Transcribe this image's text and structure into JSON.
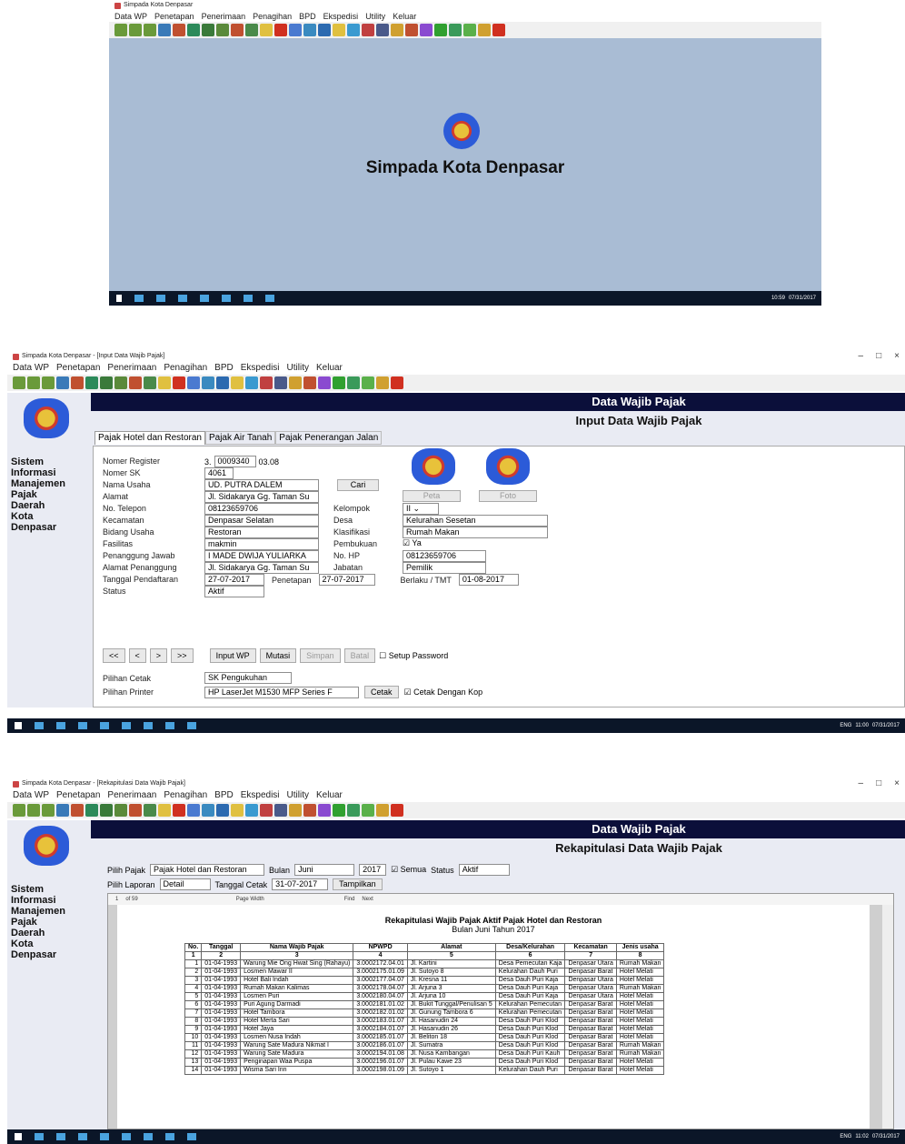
{
  "shot1": {
    "title": "Simpada Kota Denpasar",
    "menu": [
      "Data WP",
      "Penetapan",
      "Penerimaan",
      "Penagihan",
      "BPD",
      "Ekspedisi",
      "Utility",
      "Keluar"
    ],
    "splash_text": "Simpada Kota Denpasar",
    "clock_time": "10:59",
    "clock_date": "07/31/2017"
  },
  "shot2": {
    "title": "Simpada Kota Denpasar - [Input Data Wajib Pajak]",
    "menu": [
      "Data WP",
      "Penetapan",
      "Penerimaan",
      "Penagihan",
      "BPD",
      "Ekspedisi",
      "Utility",
      "Keluar"
    ],
    "header_title": "Data Wajib Pajak",
    "header_subtitle": "Input Data Wajib Pajak",
    "sidebar_text": [
      "Sistem",
      "Informasi",
      "Manajemen",
      "Pajak",
      "Daerah",
      "Kota",
      "Denpasar"
    ],
    "tabs": [
      "Pajak Hotel dan Restoran",
      "Pajak Air Tanah",
      "Pajak Penerangan Jalan"
    ],
    "labels": {
      "nomer_register": "Nomer Register",
      "nomer_sk": "Nomer SK",
      "nama_usaha": "Nama Usaha",
      "alamat": "Alamat",
      "no_telepon": "No. Telepon",
      "kecamatan": "Kecamatan",
      "bidang_usaha": "Bidang Usaha",
      "fasilitas": "Fasilitas",
      "penanggung_jawab": "Penanggung Jawab",
      "alamat_penanggung": "Alamat Penanggung",
      "tanggal_pendaftaran": "Tanggal Pendaftaran",
      "status": "Status",
      "kelompok": "Kelompok",
      "desa": "Desa",
      "klasifikasi": "Klasifikasi",
      "pembukuan": "Pembukuan",
      "no_hp": "No. HP",
      "jabatan": "Jabatan",
      "penetapan": "Penetapan",
      "berlaku": "Berlaku / TMT",
      "pilihan_cetak": "Pilihan Cetak",
      "pilihan_printer": "Pilihan Printer"
    },
    "values": {
      "reg_prefix": "3.",
      "reg_number": "0009340",
      "reg_suffix": "03.08",
      "nomer_sk": "4061",
      "nama_usaha": "UD. PUTRA DALEM",
      "alamat": "Jl. Sidakarya Gg. Taman Su",
      "no_telepon": "08123659706",
      "kecamatan": "Denpasar Selatan",
      "bidang_usaha": "Restoran",
      "fasilitas": "makmin",
      "penanggung_jawab": "I MADE DWIJA YULIARKA",
      "alamat_penanggung": "Jl. Sidakarya Gg. Taman Su",
      "tanggal_pendaftaran": "27-07-2017",
      "status": "Aktif",
      "kelompok": "II",
      "desa": "Kelurahan Sesetan",
      "klasifikasi": "Rumah Makan",
      "pembukuan": "Ya",
      "no_hp": "08123659706",
      "jabatan": "Pemilik",
      "penetapan": "27-07-2017",
      "berlaku": "01-08-2017",
      "pilihan_cetak": "SK Pengukuhan",
      "pilihan_printer": "HP LaserJet M1530 MFP Series F",
      "cetak_dengan_kop": "Cetak Dengan Kop",
      "setup_password": "Setup Password"
    },
    "buttons": {
      "cari": "Cari",
      "peta": "Peta",
      "foto": "Foto",
      "first": "<<",
      "prev": "<",
      "next": ">",
      "last": ">>",
      "input_wp": "Input WP",
      "mutasi": "Mutasi",
      "simpan": "Simpan",
      "batal": "Batal",
      "cetak": "Cetak"
    },
    "clock_time": "11:00",
    "clock_date": "07/31/2017",
    "lang": "ENG"
  },
  "shot3": {
    "title": "Simpada Kota Denpasar - [Rekapitulasi Data Wajib Pajak]",
    "menu": [
      "Data WP",
      "Penetapan",
      "Penerimaan",
      "Penagihan",
      "BPD",
      "Ekspedisi",
      "Utility",
      "Keluar"
    ],
    "header_title": "Data Wajib Pajak",
    "header_subtitle": "Rekapitulasi Data Wajib Pajak",
    "sidebar_text": [
      "Sistem",
      "Informasi",
      "Manajemen",
      "Pajak",
      "Daerah",
      "Kota",
      "Denpasar"
    ],
    "filters": {
      "pilih_pajak_label": "Pilih Pajak",
      "pilih_pajak": "Pajak Hotel dan Restoran",
      "bulan_label": "Bulan",
      "bulan": "Juni",
      "tahun": "2017",
      "semua": "Semua",
      "status_label": "Status",
      "status": "Aktif",
      "pilih_laporan_label": "Pilih Laporan",
      "pilih_laporan": "Detail",
      "tanggal_cetak_label": "Tanggal Cetak",
      "tanggal_cetak": "31-07-2017",
      "tampilkan": "Tampilkan"
    },
    "report_toolbar": {
      "page": "1",
      "of": "of 59",
      "zoom": "Page Width",
      "find": "Find",
      "next": "Next"
    },
    "report_title": "Rekapitulasi Wajib Pajak Aktif Pajak Hotel dan Restoran",
    "report_subtitle": "Bulan Juni Tahun 2017",
    "columns": [
      "No.",
      "Tanggal",
      "Nama Wajib Pajak",
      "NPWPD",
      "Alamat",
      "Desa/Kelurahan",
      "Kecamatan",
      "Jenis usaha"
    ],
    "column_numbers": [
      "1",
      "2",
      "3",
      "4",
      "5",
      "6",
      "7",
      "8"
    ],
    "rows": [
      [
        "1",
        "01-04-1993",
        "Warung Mie Ong Hwat Sing (Rahayu)",
        "3.0002172.04.01",
        "Jl. Kartini",
        "Desa Pemecutan Kaja",
        "Denpasar Utara",
        "Rumah Makan"
      ],
      [
        "2",
        "01-04-1993",
        "Losmen Mawar II",
        "3.0002175.01.09",
        "Jl. Sutoyo 8",
        "Kelurahan Dauh Puri",
        "Denpasar Barat",
        "Hotel Melati"
      ],
      [
        "3",
        "01-04-1993",
        "Hotel Bali Indah",
        "3.0002177.04.07",
        "Jl. Kresna 11",
        "Desa Dauh Puri Kaja",
        "Denpasar Utara",
        "Hotel Melati"
      ],
      [
        "4",
        "01-04-1993",
        "Rumah Makan Kalimas",
        "3.0002178.04.07",
        "Jl. Arjuna 3",
        "Desa Dauh Puri Kaja",
        "Denpasar Utara",
        "Rumah Makan"
      ],
      [
        "5",
        "01-04-1993",
        "Losmen Puri",
        "3.0002180.04.07",
        "Jl. Arjuna 10",
        "Desa Dauh Puri Kaja",
        "Denpasar Utara",
        "Hotel Melati"
      ],
      [
        "6",
        "01-04-1993",
        "Puri Agung Darmadi",
        "3.0002181.01.02",
        "Jl. Bukit Tunggal/Penulisan 5",
        "Kelurahan Pemecutan",
        "Denpasar Barat",
        "Hotel Melati"
      ],
      [
        "7",
        "01-04-1993",
        "Hotel Tambora",
        "3.0002182.01.02",
        "Jl. Gunung Tambora 6",
        "Kelurahan Pemecutan",
        "Denpasar Barat",
        "Hotel Melati"
      ],
      [
        "8",
        "01-04-1993",
        "Hotel Merta Sari",
        "3.0002183.01.07",
        "Jl. Hasanudin 24",
        "Desa Dauh Puri Klod",
        "Denpasar Barat",
        "Hotel Melati"
      ],
      [
        "9",
        "01-04-1993",
        "Hotel Jaya",
        "3.0002184.01.07",
        "Jl. Hasanudin 26",
        "Desa Dauh Puri Klod",
        "Denpasar Barat",
        "Hotel Melati"
      ],
      [
        "10",
        "01-04-1993",
        "Losmen Nusa Indah",
        "3.0002185.01.07",
        "Jl. Beliton 18",
        "Desa Dauh Puri Klod",
        "Denpasar Barat",
        "Hotel Melati"
      ],
      [
        "11",
        "01-04-1993",
        "Warung Sate Madura Nikmat I",
        "3.0002186.01.07",
        "Jl. Sumatra",
        "Desa Dauh Puri Klod",
        "Denpasar Barat",
        "Rumah Makan"
      ],
      [
        "12",
        "01-04-1993",
        "Warung Sate Madura",
        "3.0002194.01.08",
        "Jl. Nusa Kambangan",
        "Desa Dauh Puri Kauh",
        "Denpasar Barat",
        "Rumah Makan"
      ],
      [
        "13",
        "01-04-1993",
        "Penginapan Waa Puspa",
        "3.0002196.01.07",
        "Jl. Pulau Kawe 23",
        "Desa Dauh Puri Klod",
        "Denpasar Barat",
        "Hotel Melati"
      ],
      [
        "14",
        "01-04-1993",
        "Wisma Sari Inn",
        "3.0002198.01.09",
        "Jl. Sutoyo 1",
        "Kelurahan Dauh Puri",
        "Denpasar Barat",
        "Hotel Melati"
      ]
    ],
    "clock_time": "11:02",
    "clock_date": "07/31/2017",
    "lang": "ENG"
  },
  "colors": {
    "splash_bg": "#a9bcd4",
    "header_bg": "#0b0f3a",
    "taskbar": "#0b1628",
    "accent": "#2c5bd8"
  },
  "icons": [
    "app-icon",
    "toolbar-icon",
    "logo-icon",
    "close-icon",
    "minimize-icon",
    "maximize-icon",
    "windows-start-icon"
  ]
}
